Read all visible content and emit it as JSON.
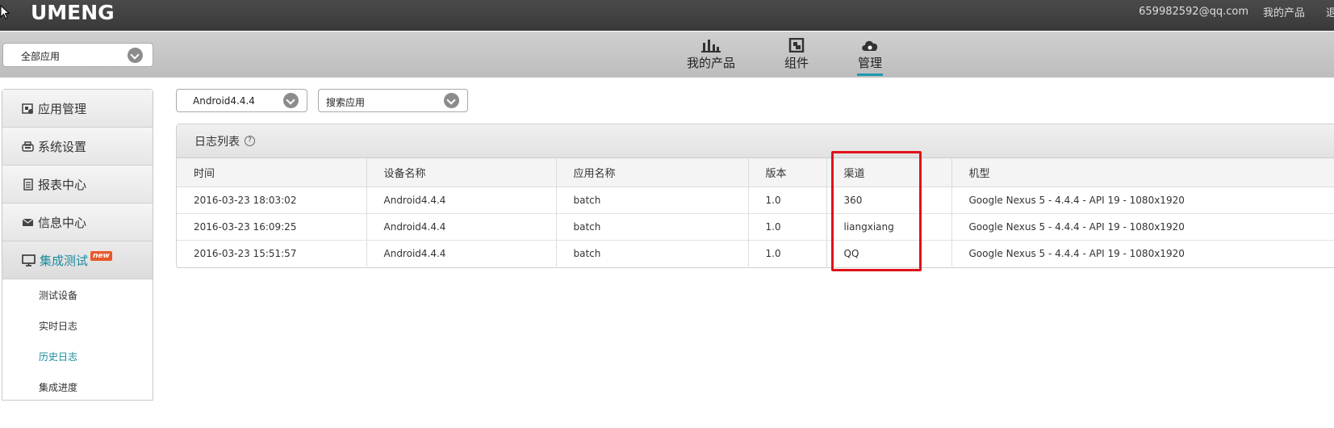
{
  "header": {
    "logo_text": "UMENG",
    "user_email": "659982592@qq.com",
    "my_products_link": "我的产品",
    "truncated_link": "退"
  },
  "navbar": {
    "app_selector": {
      "value": "全部应用"
    },
    "tabs": [
      {
        "label": "我的产品",
        "icon": "bar-chart-icon"
      },
      {
        "label": "组件",
        "icon": "component-icon"
      },
      {
        "label": "管理",
        "icon": "cloud-manage-icon",
        "active": true
      }
    ]
  },
  "sidebar": {
    "items": [
      {
        "label": "应用管理",
        "icon": "app-manage-icon"
      },
      {
        "label": "系统设置",
        "icon": "settings-icon"
      },
      {
        "label": "报表中心",
        "icon": "report-icon"
      },
      {
        "label": "信息中心",
        "icon": "mail-icon"
      },
      {
        "label": "集成测试",
        "icon": "monitor-icon",
        "badge": "new",
        "active": true
      }
    ],
    "sub_items": [
      {
        "label": "测试设备"
      },
      {
        "label": "实时日志"
      },
      {
        "label": "历史日志",
        "active": true
      },
      {
        "label": "集成进度"
      }
    ]
  },
  "filters": {
    "device_select": {
      "value": "Android4.4.4"
    },
    "app_search": {
      "value": "搜索应用"
    }
  },
  "log_panel": {
    "title": "日志列表",
    "help_icon": "?",
    "columns": [
      "时间",
      "设备名称",
      "应用名称",
      "版本",
      "渠道",
      "机型"
    ],
    "rows": [
      [
        "2016-03-23 18:03:02",
        "Android4.4.4",
        "batch",
        "1.0",
        "360",
        "Google Nexus 5 - 4.4.4 - API 19 - 1080x1920"
      ],
      [
        "2016-03-23 16:09:25",
        "Android4.4.4",
        "batch",
        "1.0",
        "liangxiang",
        "Google Nexus 5 - 4.4.4 - API 19 - 1080x1920"
      ],
      [
        "2016-03-23 15:51:57",
        "Android4.4.4",
        "batch",
        "1.0",
        "QQ",
        "Google Nexus 5 - 4.4.4 - API 19 - 1080x1920"
      ]
    ]
  },
  "colors": {
    "accent_teal": "#1a9ab0",
    "highlight_red": "#e0111a",
    "new_badge": "#e8582a"
  }
}
